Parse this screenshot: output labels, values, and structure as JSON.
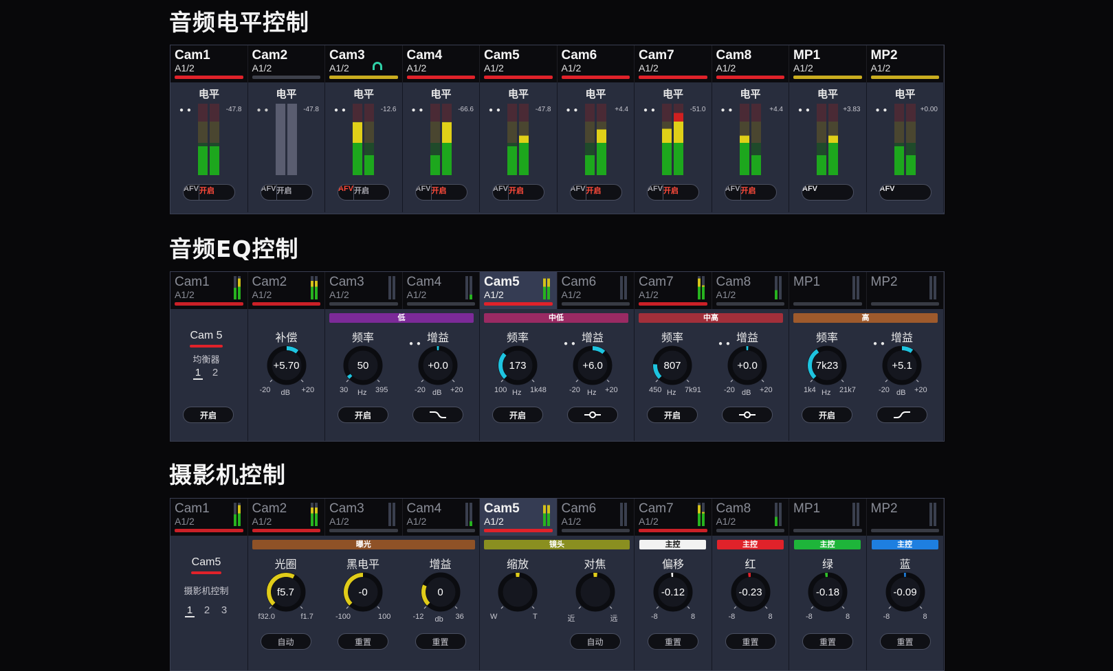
{
  "titles": {
    "level": "音频电平控制",
    "eq": "音频EQ控制",
    "camera": "摄影机控制"
  },
  "colors": {
    "red": "#e0222a",
    "yellow": "#c9ad1f",
    "gray": "#3d404a",
    "green": "#2fc22a",
    "cyan": "#1ec4e0",
    "yellowKnob": "#e0cc1a",
    "white": "#f2f2f2",
    "blue": "#1e7fe0",
    "bg": "#282d3d"
  },
  "level": {
    "channels": [
      {
        "name": "Cam1",
        "sub": "A1/2",
        "bar": "red",
        "db": "-47.8",
        "afv": "AFV",
        "on": "开启",
        "afvActive": false,
        "onActive": true,
        "fill": [
          0.4,
          0.4
        ],
        "headphone": false,
        "dimmed": false
      },
      {
        "name": "Cam2",
        "sub": "A1/2",
        "bar": "gray",
        "db": "-47.8",
        "afv": "AFV",
        "on": "开启",
        "afvActive": false,
        "onActive": false,
        "fill": [
          0,
          0
        ],
        "headphone": false,
        "dimmed": true
      },
      {
        "name": "Cam3",
        "sub": "A1/2",
        "bar": "yellow",
        "db": "-12.6",
        "afv": "AFV",
        "on": "开启",
        "afvActive": true,
        "onActive": false,
        "fill": [
          0.74,
          0.28
        ],
        "headphone": true,
        "dimmed": false
      },
      {
        "name": "Cam4",
        "sub": "A1/2",
        "bar": "red",
        "db": "-66.6",
        "afv": "AFV",
        "on": "开启",
        "afvActive": false,
        "onActive": true,
        "fill": [
          0.28,
          0.74
        ],
        "headphone": false,
        "dimmed": false
      },
      {
        "name": "Cam5",
        "sub": "A1/2",
        "bar": "red",
        "db": "-47.8",
        "afv": "AFV",
        "on": "开启",
        "afvActive": false,
        "onActive": true,
        "fill": [
          0.4,
          0.55
        ],
        "headphone": false,
        "dimmed": false
      },
      {
        "name": "Cam6",
        "sub": "A1/2",
        "bar": "red",
        "db": "+4.4",
        "afv": "AFV",
        "on": "开启",
        "afvActive": false,
        "onActive": true,
        "fill": [
          0.28,
          0.64
        ],
        "headphone": false,
        "dimmed": false
      },
      {
        "name": "Cam7",
        "sub": "A1/2",
        "bar": "red",
        "db": "-51.0",
        "afv": "AFV",
        "on": "开启",
        "afvActive": false,
        "onActive": true,
        "fill": [
          0.65,
          0.87
        ],
        "headphone": false,
        "dimmed": false
      },
      {
        "name": "Cam8",
        "sub": "A1/2",
        "bar": "red",
        "db": "+4.4",
        "afv": "AFV",
        "on": "开启",
        "afvActive": false,
        "onActive": true,
        "fill": [
          0.55,
          0.28
        ],
        "headphone": false,
        "dimmed": false
      },
      {
        "name": "MP1",
        "sub": "A1/2",
        "bar": "yellow",
        "db": "+3.83",
        "afv": "AFV",
        "on": "",
        "afvActive": false,
        "onActive": false,
        "fill": [
          0.28,
          0.55
        ],
        "headphone": false,
        "dimmed": false,
        "single": true
      },
      {
        "name": "MP2",
        "sub": "A1/2",
        "bar": "yellow",
        "db": "+0.00",
        "afv": "AFV",
        "on": "",
        "afvActive": false,
        "onActive": false,
        "fill": [
          0.4,
          0.28
        ],
        "headphone": false,
        "dimmed": false,
        "single": true
      }
    ],
    "label": "电平"
  },
  "eqTabs": [
    {
      "name": "Cam1",
      "sub": "A1/2",
      "bar": "red",
      "sel": false,
      "bright": false,
      "mini": [
        0.5,
        0.9
      ]
    },
    {
      "name": "Cam2",
      "sub": "A1/2",
      "bar": "red",
      "sel": false,
      "bright": false,
      "mini": [
        0.8,
        0.8
      ]
    },
    {
      "name": "Cam3",
      "sub": "A1/2",
      "bar": "gray",
      "sel": false,
      "bright": false,
      "mini": [
        0,
        0
      ]
    },
    {
      "name": "Cam4",
      "sub": "A1/2",
      "bar": "gray",
      "sel": false,
      "bright": false,
      "mini": [
        0,
        0.2
      ]
    },
    {
      "name": "Cam5",
      "sub": "A1/2",
      "bar": "red",
      "sel": true,
      "bright": true,
      "mini": [
        0.9,
        0.9
      ]
    },
    {
      "name": "Cam6",
      "sub": "A1/2",
      "bar": "gray",
      "sel": false,
      "bright": false,
      "mini": [
        0,
        0
      ]
    },
    {
      "name": "Cam7",
      "sub": "A1/2",
      "bar": "red",
      "sel": false,
      "bright": false,
      "mini": [
        0.9,
        0.6
      ]
    },
    {
      "name": "Cam8",
      "sub": "A1/2",
      "bar": "gray",
      "sel": false,
      "bright": false,
      "mini": [
        0.4,
        0
      ]
    },
    {
      "name": "MP1",
      "sub": "",
      "bar": "gray",
      "sel": false,
      "bright": false,
      "mini": [
        0,
        0
      ]
    },
    {
      "name": "MP2",
      "sub": "",
      "bar": "gray",
      "sel": false,
      "bright": false,
      "mini": [
        0,
        0
      ]
    }
  ],
  "eq": {
    "cam": "Cam 5",
    "eqLabel": "均衡器",
    "pages": [
      "1",
      "2"
    ],
    "on": "开启",
    "comp": {
      "label": "补偿",
      "value": "+5.70",
      "min": "-20",
      "max": "+20",
      "unit": "dB",
      "pos": 0.64
    },
    "bands": [
      {
        "title": "低",
        "color": "#7c2a98",
        "freq": {
          "label": "频率",
          "value": "50",
          "min": "30",
          "max": "395",
          "unit": "Hz",
          "pos": 0.04
        },
        "gain": {
          "label": "增益",
          "value": "+0.0",
          "min": "-20",
          "max": "+20",
          "unit": "dB",
          "pos": 0.5
        },
        "on": "开启",
        "shape": "shelf-low"
      },
      {
        "title": "中低",
        "color": "#9a2a63",
        "freq": {
          "label": "频率",
          "value": "173",
          "min": "100",
          "max": "1k48",
          "unit": "Hz",
          "pos": 0.32
        },
        "gain": {
          "label": "增益",
          "value": "+6.0",
          "min": "-20",
          "max": "+20",
          "unit": "Hz",
          "pos": 0.65
        },
        "on": "开启",
        "shape": "bell"
      },
      {
        "title": "中高",
        "color": "#a22f3a",
        "freq": {
          "label": "频率",
          "value": "807",
          "min": "450",
          "max": "7k91",
          "unit": "Hz",
          "pos": 0.18
        },
        "gain": {
          "label": "增益",
          "value": "+0.0",
          "min": "-20",
          "max": "+20",
          "unit": "dB",
          "pos": 0.5
        },
        "on": "开启",
        "shape": "bell"
      },
      {
        "title": "高",
        "color": "#9e5a2c",
        "freq": {
          "label": "频率",
          "value": "7k23",
          "min": "1k4",
          "max": "21k7",
          "unit": "Hz",
          "pos": 0.38
        },
        "gain": {
          "label": "增益",
          "value": "+5.1",
          "min": "-20",
          "max": "+20",
          "unit": "dB",
          "pos": 0.63
        },
        "on": "开启",
        "shape": "shelf-high"
      }
    ]
  },
  "cameraTabs": [
    {
      "name": "Cam1",
      "sub": "A1/2",
      "bar": "red",
      "sel": false,
      "bright": false,
      "mini": [
        0.5,
        0.9
      ]
    },
    {
      "name": "Cam2",
      "sub": "A1/2",
      "bar": "red",
      "sel": false,
      "bright": false,
      "mini": [
        0.8,
        0.8
      ]
    },
    {
      "name": "Cam3",
      "sub": "A1/2",
      "bar": "gray",
      "sel": false,
      "bright": false,
      "mini": [
        0,
        0
      ]
    },
    {
      "name": "Cam4",
      "sub": "A1/2",
      "bar": "gray",
      "sel": false,
      "bright": false,
      "mini": [
        0,
        0.2
      ]
    },
    {
      "name": "Cam5",
      "sub": "A1/2",
      "bar": "red",
      "sel": true,
      "bright": true,
      "mini": [
        0.9,
        0.9
      ]
    },
    {
      "name": "Cam6",
      "sub": "A1/2",
      "bar": "gray",
      "sel": false,
      "bright": false,
      "mini": [
        0,
        0
      ]
    },
    {
      "name": "Cam7",
      "sub": "A1/2",
      "bar": "red",
      "sel": false,
      "bright": false,
      "mini": [
        0.9,
        0.6
      ]
    },
    {
      "name": "Cam8",
      "sub": "A1/2",
      "bar": "gray",
      "sel": false,
      "bright": false,
      "mini": [
        0.4,
        0
      ]
    },
    {
      "name": "MP1",
      "sub": "",
      "bar": "gray",
      "sel": false,
      "bright": false,
      "mini": [
        0,
        0
      ]
    },
    {
      "name": "MP2",
      "sub": "",
      "bar": "gray",
      "sel": false,
      "bright": false,
      "mini": [
        0,
        0
      ]
    }
  ],
  "camera": {
    "cam": "Cam5",
    "label": "摄影机控制",
    "pages": [
      "1",
      "2",
      "3"
    ],
    "exposure": {
      "title": "曝光",
      "color": "#8f5227",
      "knobs": [
        {
          "label": "光圈",
          "value": "f5.7",
          "min": "f32.0",
          "max": "f1.7",
          "pos": 0.6,
          "btn": "自动",
          "color": "yellowKnob"
        },
        {
          "label": "黑电平",
          "value": "-0",
          "min": "-100",
          "max": "100",
          "pos": 0.5,
          "btn": "重置",
          "color": "yellowKnob"
        },
        {
          "label": "增益",
          "value": "0",
          "min": "-12",
          "max": "36",
          "unit": "db",
          "pos": 0.25,
          "btn": "重置",
          "color": "yellowKnob"
        }
      ]
    },
    "lens": {
      "title": "镜头",
      "color": "#8a8f20",
      "knobs": [
        {
          "label": "缩放",
          "value": "",
          "min": "W",
          "max": "T",
          "pos": 0.5,
          "btn": "",
          "color": "yellowKnob",
          "dot": true
        },
        {
          "label": "对焦",
          "value": "",
          "min": "近",
          "max": "远",
          "pos": 0.5,
          "btn": "自动",
          "color": "yellowKnob",
          "dot": true
        }
      ]
    },
    "master": [
      {
        "title": "主控",
        "titleColor": "#f2f2f2",
        "titleText": "#111",
        "label": "偏移",
        "value": "-0.12",
        "min": "-8",
        "max": "8",
        "pos": 0.48,
        "btn": "重置",
        "color": "white"
      },
      {
        "title": "主控",
        "titleColor": "#e0222a",
        "titleText": "#fff",
        "label": "红",
        "value": "-0.23",
        "min": "-8",
        "max": "8",
        "pos": 0.47,
        "btn": "重置",
        "color": "red"
      },
      {
        "title": "主控",
        "titleColor": "#1eb53a",
        "titleText": "#fff",
        "label": "绿",
        "value": "-0.18",
        "min": "-8",
        "max": "8",
        "pos": 0.47,
        "btn": "重置",
        "color": "green"
      },
      {
        "title": "主控",
        "titleColor": "#1e7fe0",
        "titleText": "#fff",
        "label": "蓝",
        "value": "-0.09",
        "min": "-8",
        "max": "8",
        "pos": 0.49,
        "btn": "重置",
        "color": "blue"
      }
    ]
  }
}
